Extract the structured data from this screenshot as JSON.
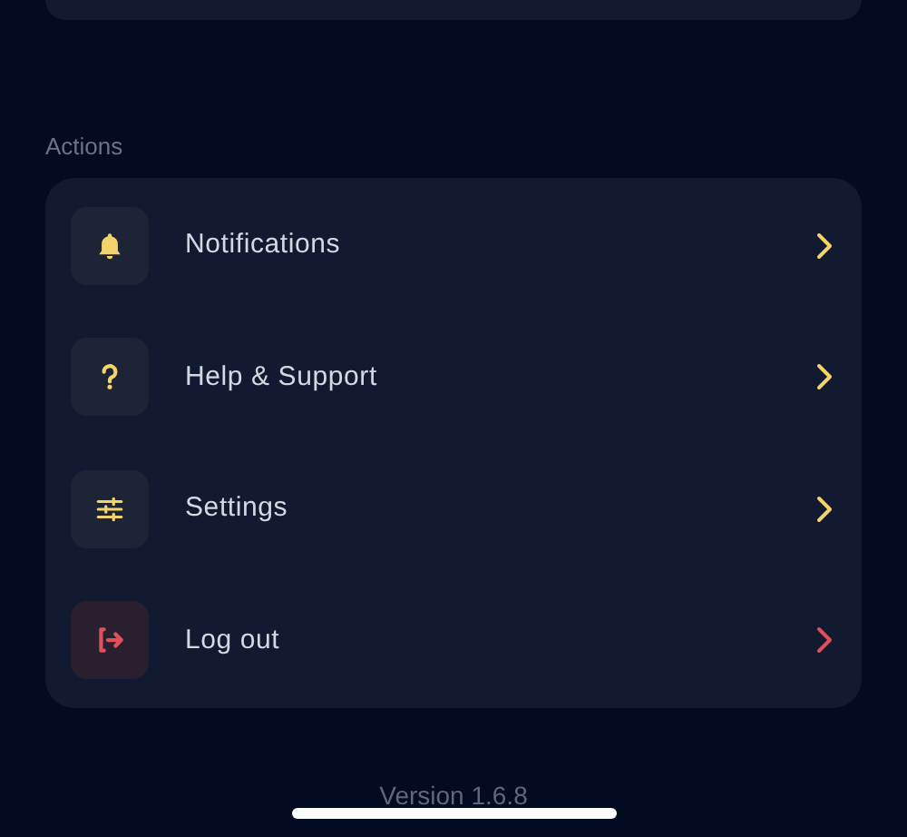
{
  "section_title": "Actions",
  "actions": [
    {
      "label": "Notifications",
      "kind": "normal"
    },
    {
      "label": "Help & Support",
      "kind": "normal"
    },
    {
      "label": "Settings",
      "kind": "normal"
    },
    {
      "label": "Log out",
      "kind": "danger"
    }
  ],
  "version": "Version 1.6.8"
}
